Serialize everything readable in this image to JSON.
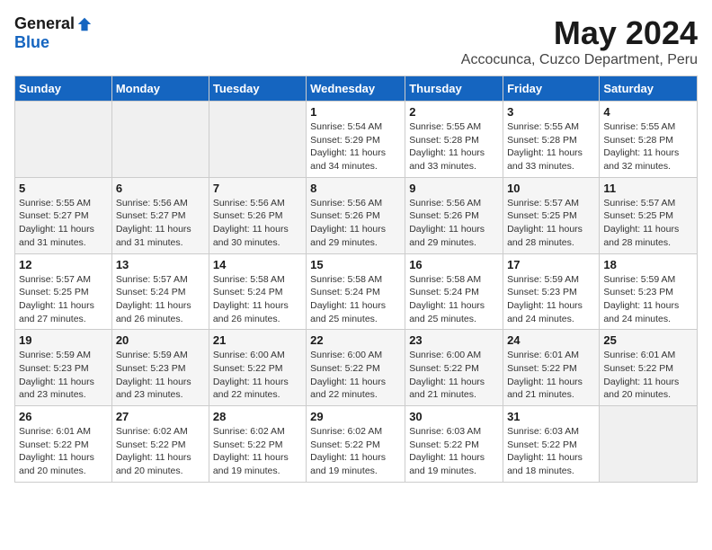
{
  "logo": {
    "general": "General",
    "blue": "Blue"
  },
  "title": "May 2024",
  "location": "Accocunca, Cuzco Department, Peru",
  "days_of_week": [
    "Sunday",
    "Monday",
    "Tuesday",
    "Wednesday",
    "Thursday",
    "Friday",
    "Saturday"
  ],
  "weeks": [
    [
      {
        "day": "",
        "sunrise": "",
        "sunset": "",
        "daylight": ""
      },
      {
        "day": "",
        "sunrise": "",
        "sunset": "",
        "daylight": ""
      },
      {
        "day": "",
        "sunrise": "",
        "sunset": "",
        "daylight": ""
      },
      {
        "day": "1",
        "sunrise": "Sunrise: 5:54 AM",
        "sunset": "Sunset: 5:29 PM",
        "daylight": "Daylight: 11 hours and 34 minutes."
      },
      {
        "day": "2",
        "sunrise": "Sunrise: 5:55 AM",
        "sunset": "Sunset: 5:28 PM",
        "daylight": "Daylight: 11 hours and 33 minutes."
      },
      {
        "day": "3",
        "sunrise": "Sunrise: 5:55 AM",
        "sunset": "Sunset: 5:28 PM",
        "daylight": "Daylight: 11 hours and 33 minutes."
      },
      {
        "day": "4",
        "sunrise": "Sunrise: 5:55 AM",
        "sunset": "Sunset: 5:28 PM",
        "daylight": "Daylight: 11 hours and 32 minutes."
      }
    ],
    [
      {
        "day": "5",
        "sunrise": "Sunrise: 5:55 AM",
        "sunset": "Sunset: 5:27 PM",
        "daylight": "Daylight: 11 hours and 31 minutes."
      },
      {
        "day": "6",
        "sunrise": "Sunrise: 5:56 AM",
        "sunset": "Sunset: 5:27 PM",
        "daylight": "Daylight: 11 hours and 31 minutes."
      },
      {
        "day": "7",
        "sunrise": "Sunrise: 5:56 AM",
        "sunset": "Sunset: 5:26 PM",
        "daylight": "Daylight: 11 hours and 30 minutes."
      },
      {
        "day": "8",
        "sunrise": "Sunrise: 5:56 AM",
        "sunset": "Sunset: 5:26 PM",
        "daylight": "Daylight: 11 hours and 29 minutes."
      },
      {
        "day": "9",
        "sunrise": "Sunrise: 5:56 AM",
        "sunset": "Sunset: 5:26 PM",
        "daylight": "Daylight: 11 hours and 29 minutes."
      },
      {
        "day": "10",
        "sunrise": "Sunrise: 5:57 AM",
        "sunset": "Sunset: 5:25 PM",
        "daylight": "Daylight: 11 hours and 28 minutes."
      },
      {
        "day": "11",
        "sunrise": "Sunrise: 5:57 AM",
        "sunset": "Sunset: 5:25 PM",
        "daylight": "Daylight: 11 hours and 28 minutes."
      }
    ],
    [
      {
        "day": "12",
        "sunrise": "Sunrise: 5:57 AM",
        "sunset": "Sunset: 5:25 PM",
        "daylight": "Daylight: 11 hours and 27 minutes."
      },
      {
        "day": "13",
        "sunrise": "Sunrise: 5:57 AM",
        "sunset": "Sunset: 5:24 PM",
        "daylight": "Daylight: 11 hours and 26 minutes."
      },
      {
        "day": "14",
        "sunrise": "Sunrise: 5:58 AM",
        "sunset": "Sunset: 5:24 PM",
        "daylight": "Daylight: 11 hours and 26 minutes."
      },
      {
        "day": "15",
        "sunrise": "Sunrise: 5:58 AM",
        "sunset": "Sunset: 5:24 PM",
        "daylight": "Daylight: 11 hours and 25 minutes."
      },
      {
        "day": "16",
        "sunrise": "Sunrise: 5:58 AM",
        "sunset": "Sunset: 5:24 PM",
        "daylight": "Daylight: 11 hours and 25 minutes."
      },
      {
        "day": "17",
        "sunrise": "Sunrise: 5:59 AM",
        "sunset": "Sunset: 5:23 PM",
        "daylight": "Daylight: 11 hours and 24 minutes."
      },
      {
        "day": "18",
        "sunrise": "Sunrise: 5:59 AM",
        "sunset": "Sunset: 5:23 PM",
        "daylight": "Daylight: 11 hours and 24 minutes."
      }
    ],
    [
      {
        "day": "19",
        "sunrise": "Sunrise: 5:59 AM",
        "sunset": "Sunset: 5:23 PM",
        "daylight": "Daylight: 11 hours and 23 minutes."
      },
      {
        "day": "20",
        "sunrise": "Sunrise: 5:59 AM",
        "sunset": "Sunset: 5:23 PM",
        "daylight": "Daylight: 11 hours and 23 minutes."
      },
      {
        "day": "21",
        "sunrise": "Sunrise: 6:00 AM",
        "sunset": "Sunset: 5:22 PM",
        "daylight": "Daylight: 11 hours and 22 minutes."
      },
      {
        "day": "22",
        "sunrise": "Sunrise: 6:00 AM",
        "sunset": "Sunset: 5:22 PM",
        "daylight": "Daylight: 11 hours and 22 minutes."
      },
      {
        "day": "23",
        "sunrise": "Sunrise: 6:00 AM",
        "sunset": "Sunset: 5:22 PM",
        "daylight": "Daylight: 11 hours and 21 minutes."
      },
      {
        "day": "24",
        "sunrise": "Sunrise: 6:01 AM",
        "sunset": "Sunset: 5:22 PM",
        "daylight": "Daylight: 11 hours and 21 minutes."
      },
      {
        "day": "25",
        "sunrise": "Sunrise: 6:01 AM",
        "sunset": "Sunset: 5:22 PM",
        "daylight": "Daylight: 11 hours and 20 minutes."
      }
    ],
    [
      {
        "day": "26",
        "sunrise": "Sunrise: 6:01 AM",
        "sunset": "Sunset: 5:22 PM",
        "daylight": "Daylight: 11 hours and 20 minutes."
      },
      {
        "day": "27",
        "sunrise": "Sunrise: 6:02 AM",
        "sunset": "Sunset: 5:22 PM",
        "daylight": "Daylight: 11 hours and 20 minutes."
      },
      {
        "day": "28",
        "sunrise": "Sunrise: 6:02 AM",
        "sunset": "Sunset: 5:22 PM",
        "daylight": "Daylight: 11 hours and 19 minutes."
      },
      {
        "day": "29",
        "sunrise": "Sunrise: 6:02 AM",
        "sunset": "Sunset: 5:22 PM",
        "daylight": "Daylight: 11 hours and 19 minutes."
      },
      {
        "day": "30",
        "sunrise": "Sunrise: 6:03 AM",
        "sunset": "Sunset: 5:22 PM",
        "daylight": "Daylight: 11 hours and 19 minutes."
      },
      {
        "day": "31",
        "sunrise": "Sunrise: 6:03 AM",
        "sunset": "Sunset: 5:22 PM",
        "daylight": "Daylight: 11 hours and 18 minutes."
      },
      {
        "day": "",
        "sunrise": "",
        "sunset": "",
        "daylight": ""
      }
    ]
  ]
}
